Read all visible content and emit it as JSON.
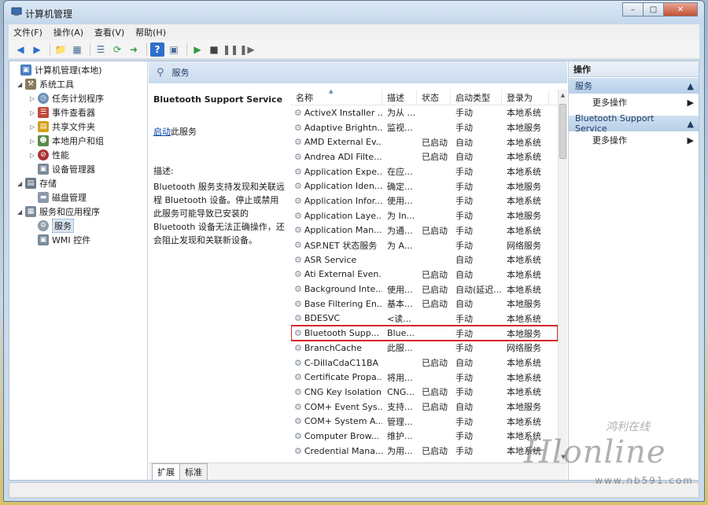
{
  "window": {
    "title": "计算机管理",
    "controls": [
      "minimize",
      "maximize",
      "close"
    ]
  },
  "menu": [
    "文件(F)",
    "操作(A)",
    "查看(V)",
    "帮助(H)"
  ],
  "toolbar_icons": [
    "back-icon",
    "forward-icon",
    "up-folder-icon",
    "show-hide-tree-icon",
    "properties-icon",
    "refresh-icon",
    "export-icon",
    "help-icon",
    "console-icon",
    "play-icon",
    "stop-icon",
    "pause-icon",
    "restart-icon"
  ],
  "tree": [
    {
      "label": "计算机管理(本地)",
      "level": 0,
      "icon": "computer-icon",
      "expanded": true
    },
    {
      "label": "系统工具",
      "level": 1,
      "icon": "tools-icon",
      "expanded": true
    },
    {
      "label": "任务计划程序",
      "level": 2,
      "icon": "clock-icon",
      "expanded": false
    },
    {
      "label": "事件查看器",
      "level": 2,
      "icon": "event-viewer-icon",
      "expanded": false
    },
    {
      "label": "共享文件夹",
      "level": 2,
      "icon": "shared-folder-icon",
      "expanded": false
    },
    {
      "label": "本地用户和组",
      "level": 2,
      "icon": "users-icon",
      "expanded": false
    },
    {
      "label": "性能",
      "level": 2,
      "icon": "performance-icon",
      "expanded": false
    },
    {
      "label": "设备管理器",
      "level": 2,
      "icon": "device-manager-icon",
      "expanded": null
    },
    {
      "label": "存储",
      "level": 1,
      "icon": "storage-icon",
      "expanded": true
    },
    {
      "label": "磁盘管理",
      "level": 2,
      "icon": "disk-icon",
      "expanded": null
    },
    {
      "label": "服务和应用程序",
      "level": 1,
      "icon": "services-apps-icon",
      "expanded": true
    },
    {
      "label": "服务",
      "level": 2,
      "icon": "gear-icon",
      "expanded": null,
      "selected": true
    },
    {
      "label": "WMI 控件",
      "level": 2,
      "icon": "wmi-icon",
      "expanded": null
    }
  ],
  "mid": {
    "header": "服务",
    "desc_title": "Bluetooth Support Service",
    "start_link": "启动",
    "start_suffix": "此服务",
    "desc_label": "描述:",
    "desc_text": "Bluetooth 服务支持发现和关联远程 Bluetooth 设备。停止或禁用此服务可能导致已安装的 Bluetooth 设备无法正确操作，还会阻止发现和关联新设备。"
  },
  "columns": [
    "名称",
    "描述",
    "状态",
    "启动类型",
    "登录为"
  ],
  "services": [
    {
      "name": "ActiveX Installer ...",
      "desc": "为从 ...",
      "status": "",
      "start": "手动",
      "logon": "本地系统"
    },
    {
      "name": "Adaptive Brightn...",
      "desc": "监视...",
      "status": "",
      "start": "手动",
      "logon": "本地服务"
    },
    {
      "name": "AMD External Ev...",
      "desc": "",
      "status": "已启动",
      "start": "自动",
      "logon": "本地系统"
    },
    {
      "name": "Andrea ADI Filte...",
      "desc": "",
      "status": "已启动",
      "start": "自动",
      "logon": "本地系统"
    },
    {
      "name": "Application Expe...",
      "desc": "在应...",
      "status": "",
      "start": "手动",
      "logon": "本地系统"
    },
    {
      "name": "Application Iden...",
      "desc": "确定...",
      "status": "",
      "start": "手动",
      "logon": "本地服务"
    },
    {
      "name": "Application Infor...",
      "desc": "使用...",
      "status": "",
      "start": "手动",
      "logon": "本地系统"
    },
    {
      "name": "Application Laye...",
      "desc": "为 In...",
      "status": "",
      "start": "手动",
      "logon": "本地服务"
    },
    {
      "name": "Application Man...",
      "desc": "为通...",
      "status": "已启动",
      "start": "手动",
      "logon": "本地系统"
    },
    {
      "name": "ASP.NET 状态服务",
      "desc": "为 A...",
      "status": "",
      "start": "手动",
      "logon": "网络服务"
    },
    {
      "name": "ASR Service",
      "desc": "",
      "status": "",
      "start": "自动",
      "logon": "本地系统"
    },
    {
      "name": "Ati External Even...",
      "desc": "",
      "status": "已启动",
      "start": "自动",
      "logon": "本地系统"
    },
    {
      "name": "Background Inte...",
      "desc": "使用...",
      "status": "已启动",
      "start": "自动(延迟...",
      "logon": "本地系统"
    },
    {
      "name": "Base Filtering En...",
      "desc": "基本...",
      "status": "已启动",
      "start": "自动",
      "logon": "本地服务"
    },
    {
      "name": "BDESVC",
      "desc": "<读...",
      "status": "",
      "start": "手动",
      "logon": "本地系统"
    },
    {
      "name": "Bluetooth Supp...",
      "desc": "Blue...",
      "status": "",
      "start": "手动",
      "logon": "本地服务",
      "highlight": true
    },
    {
      "name": "BranchCache",
      "desc": "此服...",
      "status": "",
      "start": "手动",
      "logon": "网络服务"
    },
    {
      "name": "C-DillaCdaC11BA",
      "desc": "",
      "status": "已启动",
      "start": "自动",
      "logon": "本地系统"
    },
    {
      "name": "Certificate Propa...",
      "desc": "将用...",
      "status": "",
      "start": "手动",
      "logon": "本地系统"
    },
    {
      "name": "CNG Key Isolation",
      "desc": "CNG...",
      "status": "已启动",
      "start": "手动",
      "logon": "本地系统"
    },
    {
      "name": "COM+ Event Sys...",
      "desc": "支持...",
      "status": "已启动",
      "start": "自动",
      "logon": "本地服务"
    },
    {
      "name": "COM+ System A...",
      "desc": "管理...",
      "status": "",
      "start": "手动",
      "logon": "本地系统"
    },
    {
      "name": "Computer Brow...",
      "desc": "维护...",
      "status": "",
      "start": "手动",
      "logon": "本地系统"
    },
    {
      "name": "Credential Mana...",
      "desc": "为用...",
      "status": "已启动",
      "start": "手动",
      "logon": "本地系统"
    }
  ],
  "bottom_tabs": [
    "扩展",
    "标准"
  ],
  "actions": {
    "title": "操作",
    "groups": [
      {
        "label": "服务",
        "item": "更多操作"
      },
      {
        "label": "Bluetooth Support Service",
        "item": "更多操作"
      }
    ]
  },
  "watermark": {
    "cn": "鸿利在线",
    "main": "Hlonline",
    "url": "www.nb591.com"
  },
  "colors": {
    "highlight_border": "#d8242a",
    "header_blue": "#c9dbee",
    "link": "#0645ad"
  }
}
